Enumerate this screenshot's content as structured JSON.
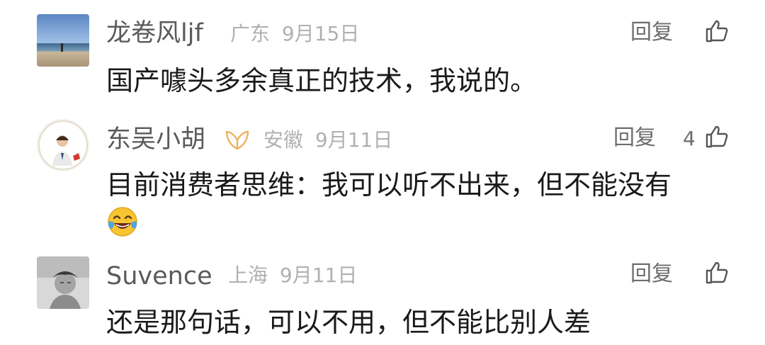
{
  "comments": [
    {
      "username": "龙卷风ljf",
      "location": "广东",
      "date": "9月15日",
      "reply_label": "回复",
      "likes": "",
      "text": "国产噱头多余真正的技术，我说的。",
      "avatar_icon": "beach-photo-avatar"
    },
    {
      "username": "东吴小胡",
      "location": "安徽",
      "date": "9月11日",
      "reply_label": "回复",
      "likes": "4",
      "text": "目前消费者思维：我可以听不出来，但不能没有",
      "emoji": "laughing-with-tears-emoji",
      "badge_icon": "vip-badge-icon",
      "avatar_icon": "person-portrait-avatar"
    },
    {
      "username": "Suvence",
      "location": "上海",
      "date": "9月11日",
      "reply_label": "回复",
      "likes": "",
      "text": "还是那句话，可以不用，但不能比别人差",
      "avatar_icon": "grayscale-portrait-avatar"
    }
  ],
  "colors": {
    "username": "#5a5a5a",
    "meta": "#b0b0b0",
    "text": "#1a1a1a",
    "badge": "#f0b060"
  }
}
